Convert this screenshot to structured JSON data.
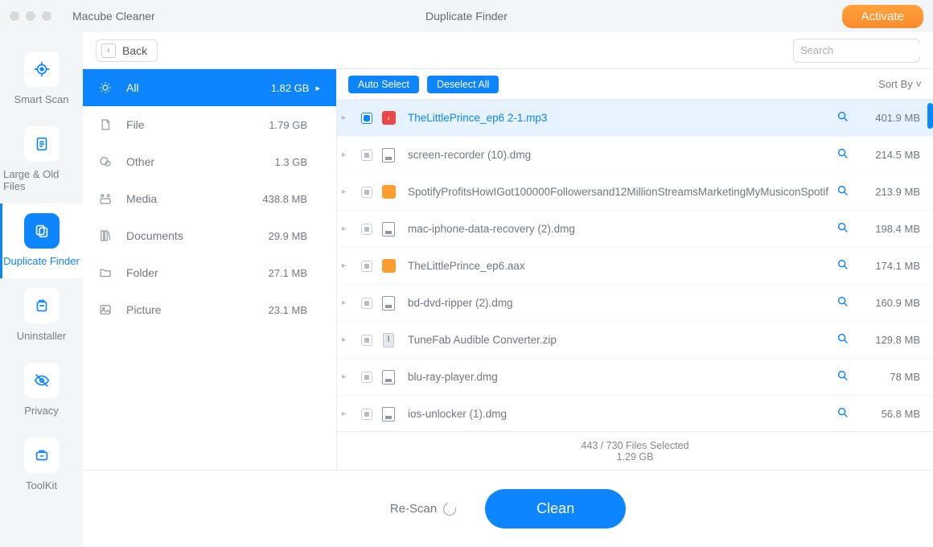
{
  "titlebar": {
    "app_name": "Macube Cleaner",
    "window_title": "Duplicate Finder",
    "activate_label": "Activate"
  },
  "sidebar": {
    "items": [
      {
        "label": "Smart Scan"
      },
      {
        "label": "Large & Old Files"
      },
      {
        "label": "Duplicate Finder"
      },
      {
        "label": "Uninstaller"
      },
      {
        "label": "Privacy"
      },
      {
        "label": "ToolKit"
      }
    ]
  },
  "topbar": {
    "back_label": "Back",
    "search_placeholder": "Search"
  },
  "categories": [
    {
      "name": "All",
      "size": "1.82 GB"
    },
    {
      "name": "File",
      "size": "1.79 GB"
    },
    {
      "name": "Other",
      "size": "1.3 GB"
    },
    {
      "name": "Media",
      "size": "438.8 MB"
    },
    {
      "name": "Documents",
      "size": "29.9 MB"
    },
    {
      "name": "Folder",
      "size": "27.1 MB"
    },
    {
      "name": "Picture",
      "size": "23.1 MB"
    }
  ],
  "file_header": {
    "auto_select": "Auto Select",
    "deselect_all": "Deselect All",
    "sort_by": "Sort By"
  },
  "files": [
    {
      "name": "TheLittlePrince_ep6 2-1.mp3",
      "size": "401.9 MB",
      "icon": "mp3",
      "selected": true
    },
    {
      "name": "screen-recorder (10).dmg",
      "size": "214.5 MB",
      "icon": "dmg",
      "selected": false
    },
    {
      "name": "SpotifyProfitsHowIGot100000Followersand12MillionStreamsMarketingMyMusiconSpotif",
      "size": "213.9 MB",
      "icon": "aud",
      "selected": false
    },
    {
      "name": "mac-iphone-data-recovery (2).dmg",
      "size": "198.4 MB",
      "icon": "dmg",
      "selected": false
    },
    {
      "name": "TheLittlePrince_ep6.aax",
      "size": "174.1 MB",
      "icon": "aud",
      "selected": false
    },
    {
      "name": "bd-dvd-ripper (2).dmg",
      "size": "160.9 MB",
      "icon": "dmg",
      "selected": false
    },
    {
      "name": "TuneFab Audible Converter.zip",
      "size": "129.8 MB",
      "icon": "zip",
      "selected": false
    },
    {
      "name": "blu-ray-player.dmg",
      "size": "78 MB",
      "icon": "dmg",
      "selected": false
    },
    {
      "name": "ios-unlocker (1).dmg",
      "size": "56.8 MB",
      "icon": "dmg",
      "selected": false
    }
  ],
  "status": {
    "line1": "443 / 730 Files Selected",
    "line2": "1.29 GB"
  },
  "footer": {
    "rescan_label": "Re-Scan",
    "clean_label": "Clean"
  },
  "colors": {
    "accent": "#0d85ff",
    "activate": "#ff9133"
  }
}
